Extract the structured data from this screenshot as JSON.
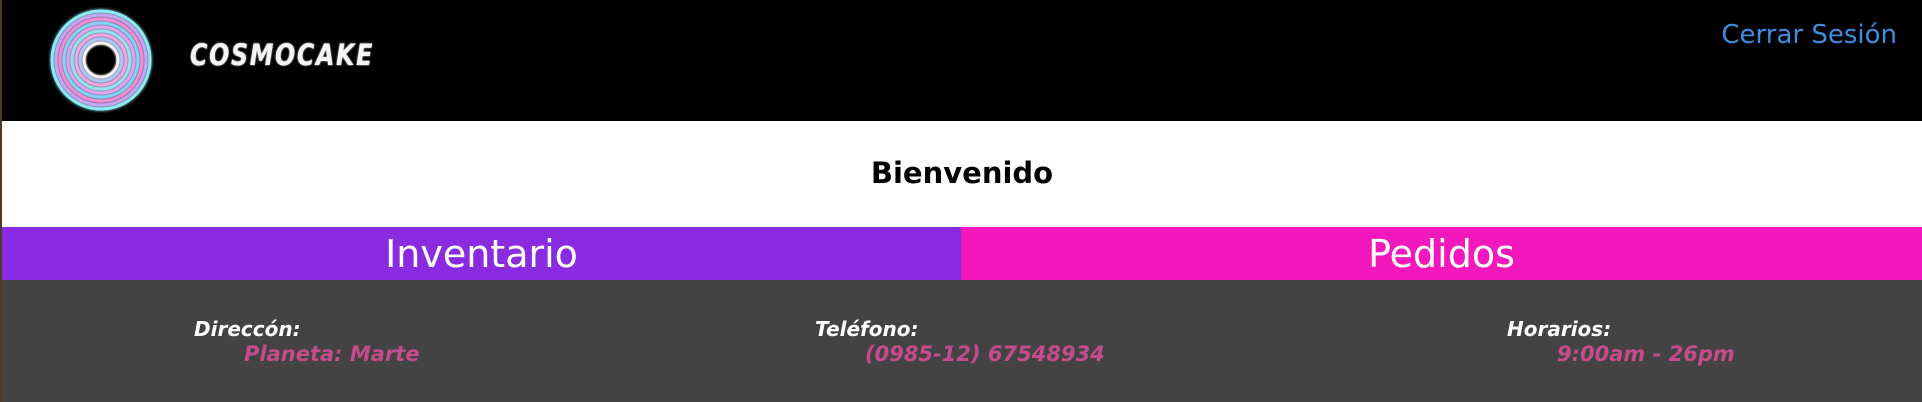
{
  "header": {
    "brand": "COSMOCAKE",
    "logout_label": "Cerrar Sesión",
    "logo_colors": [
      "#7ee8f0",
      "#c79bf2",
      "#f27ad0",
      "#6fd0f5",
      "#f0a3e0"
    ]
  },
  "welcome": {
    "title": "Bienvenido"
  },
  "nav": {
    "inventario_label": "Inventario",
    "pedidos_label": "Pedidos",
    "inventario_color": "#8a2be2",
    "pedidos_color": "#f218bb"
  },
  "footer": {
    "direccion": {
      "label": "Direccón:",
      "value": "Planeta: Marte"
    },
    "telefono": {
      "label": "Teléfono:",
      "value": "(0985-12) 67548934"
    },
    "horarios": {
      "label": "Horarios:",
      "value": "9:00am - 26pm"
    },
    "value_color": "#c64b8d"
  }
}
